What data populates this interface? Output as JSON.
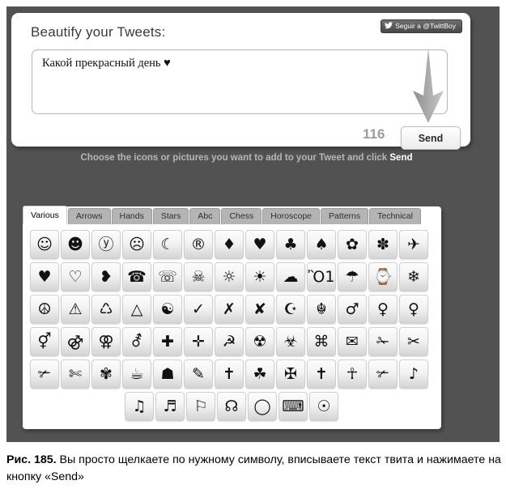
{
  "tweet_panel": {
    "title": "Beautify your Tweets:",
    "follow_button": {
      "icon": "twitter-bird-icon",
      "glyph": "ᴠ",
      "label": "Seguir a @TwittBoy"
    },
    "textarea_value": "Какой прекрасный день ♥",
    "textarea_placeholder": "",
    "char_counter": "116",
    "send_label": "Send",
    "arrow_icon": "down-arrow-icon"
  },
  "instruction": {
    "prefix": "Choose the icons or pictures you want to add to your Tweet and click ",
    "emphasis": "Send"
  },
  "picker": {
    "tabs": [
      {
        "label": "Various",
        "active": true
      },
      {
        "label": "Arrows",
        "active": false
      },
      {
        "label": "Hands",
        "active": false
      },
      {
        "label": "Stars",
        "active": false
      },
      {
        "label": "Abc",
        "active": false
      },
      {
        "label": "Chess",
        "active": false
      },
      {
        "label": "Horoscope",
        "active": false
      },
      {
        "label": "Patterns",
        "active": false
      },
      {
        "label": "Technical",
        "active": false
      }
    ],
    "rows": [
      [
        {
          "name": "white-smiling-face-icon",
          "glyph": "☺"
        },
        {
          "name": "black-smiling-face-icon",
          "glyph": "☻"
        },
        {
          "name": "circled-y-smiley-icon",
          "glyph": "ⓨ"
        },
        {
          "name": "frowning-face-icon",
          "glyph": "☹"
        },
        {
          "name": "last-quarter-moon-icon",
          "glyph": "☾"
        },
        {
          "name": "registered-sign-icon",
          "glyph": "®"
        },
        {
          "name": "black-diamond-suit-icon",
          "glyph": "♦"
        },
        {
          "name": "black-heart-suit-icon",
          "glyph": "♥"
        },
        {
          "name": "black-club-suit-icon",
          "glyph": "♣"
        },
        {
          "name": "black-spade-suit-icon",
          "glyph": "♠"
        },
        {
          "name": "flower-icon",
          "glyph": "✿"
        },
        {
          "name": "black-florette-icon",
          "glyph": "✽"
        },
        {
          "name": "airplane-icon",
          "glyph": "✈"
        }
      ],
      [
        {
          "name": "black-heart-icon",
          "glyph": "♥"
        },
        {
          "name": "white-heart-icon",
          "glyph": "♡"
        },
        {
          "name": "rotated-heart-bullet-icon",
          "glyph": "❥"
        },
        {
          "name": "black-telephone-icon",
          "glyph": "☎"
        },
        {
          "name": "white-telephone-icon",
          "glyph": "☏"
        },
        {
          "name": "skull-and-crossbones-icon",
          "glyph": "☠"
        },
        {
          "name": "white-sun-with-rays-icon",
          "glyph": "☼"
        },
        {
          "name": "black-sun-with-rays-icon",
          "glyph": "☀"
        },
        {
          "name": "black-cloud-icon",
          "glyph": "☁"
        },
        {
          "name": "light-bulb-icon",
          "glyph": "Ὂ1"
        },
        {
          "name": "umbrella-icon",
          "glyph": "☂"
        },
        {
          "name": "watch-icon",
          "glyph": "⌚"
        },
        {
          "name": "snowflake-icon",
          "glyph": "❄"
        }
      ],
      [
        {
          "name": "peace-symbol-icon",
          "glyph": "☮"
        },
        {
          "name": "warning-sign-icon",
          "glyph": "⚠"
        },
        {
          "name": "recycling-symbol-icon",
          "glyph": "♺"
        },
        {
          "name": "white-triangle-icon",
          "glyph": "△"
        },
        {
          "name": "yin-yang-icon",
          "glyph": "☯"
        },
        {
          "name": "check-mark-icon",
          "glyph": "✓"
        },
        {
          "name": "ballot-x-icon",
          "glyph": "✗"
        },
        {
          "name": "heavy-ballot-x-icon",
          "glyph": "✘"
        },
        {
          "name": "star-and-crescent-icon",
          "glyph": "☪"
        },
        {
          "name": "khanda-icon",
          "glyph": "☬"
        },
        {
          "name": "male-sign-icon",
          "glyph": "♂"
        },
        {
          "name": "female-sign-icon",
          "glyph": "♀"
        },
        {
          "name": "ankh-icon",
          "glyph": "♀"
        }
      ],
      [
        {
          "name": "male-and-female-sign-icon",
          "glyph": "⚥"
        },
        {
          "name": "doubled-male-sign-icon",
          "glyph": "⚣"
        },
        {
          "name": "doubled-female-sign-icon",
          "glyph": "⚢"
        },
        {
          "name": "male-with-stroke-sign-icon",
          "glyph": "⚦"
        },
        {
          "name": "heavy-greek-cross-icon",
          "glyph": "✚"
        },
        {
          "name": "open-centre-cross-icon",
          "glyph": "✛"
        },
        {
          "name": "hammer-and-sickle-icon",
          "glyph": "☭"
        },
        {
          "name": "radioactive-sign-icon",
          "glyph": "☢"
        },
        {
          "name": "biohazard-sign-icon",
          "glyph": "☣"
        },
        {
          "name": "place-of-interest-sign-icon",
          "glyph": "⌘"
        },
        {
          "name": "envelope-icon",
          "glyph": "✉"
        },
        {
          "name": "upper-blade-scissors-icon",
          "glyph": "✁"
        },
        {
          "name": "black-scissors-icon",
          "glyph": "✂"
        }
      ],
      [
        {
          "name": "lower-blade-scissors-icon",
          "glyph": "✃"
        },
        {
          "name": "white-scissors-icon",
          "glyph": "✄"
        },
        {
          "name": "eight-petalled-florette-icon",
          "glyph": "✾"
        },
        {
          "name": "hot-beverage-icon",
          "glyph": "☕"
        },
        {
          "name": "dark-shade-pile-icon",
          "glyph": "☗"
        },
        {
          "name": "pencil-icon",
          "glyph": "✎"
        },
        {
          "name": "syringe-icon",
          "glyph": "✝"
        },
        {
          "name": "shamrock-icon",
          "glyph": "☘"
        },
        {
          "name": "maltese-cross-icon",
          "glyph": "✠"
        },
        {
          "name": "latin-cross-icon",
          "glyph": "✝"
        },
        {
          "name": "ankh-cross-icon",
          "glyph": "☥"
        },
        {
          "name": "lower-blade-scissors-alt-icon",
          "glyph": "✃"
        },
        {
          "name": "eighth-note-icon",
          "glyph": "♪"
        }
      ],
      [
        {
          "name": "beamed-eighth-notes-icon",
          "glyph": "♫"
        },
        {
          "name": "beamed-sixteenth-notes-icon",
          "glyph": "♬"
        },
        {
          "name": "white-flag-icon",
          "glyph": "⚐"
        },
        {
          "name": "ascending-node-icon",
          "glyph": "☊"
        },
        {
          "name": "large-circle-icon",
          "glyph": "◯"
        },
        {
          "name": "keyboard-icon",
          "glyph": "⌨"
        },
        {
          "name": "sun-icon",
          "glyph": "☉"
        }
      ]
    ]
  },
  "caption": {
    "figure_number": "Рис. 185.",
    "text": "Вы просто щелкаете по нужному символу, вписываете текст твита и нажимаете на кнопку «Send»"
  },
  "colors": {
    "backdrop": "#525252",
    "accent_white": "#ffffff",
    "counter_gray": "#9c9c9c",
    "tab_inactive": "#b4b4b4"
  }
}
